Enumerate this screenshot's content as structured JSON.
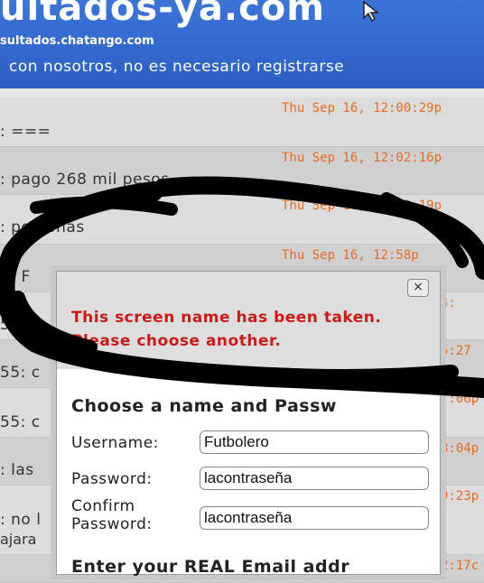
{
  "header": {
    "site_title": "ultados-ya.com",
    "site_url": "sultados.chatango.com",
    "tagline": "con nosotros, no es necesario registrarse"
  },
  "chat": {
    "rows": [
      {
        "message": ": ===",
        "timestamp": "Thu Sep 16, 12:00:29p"
      },
      {
        "message": ": pago 268 mil pesos",
        "timestamp": "Thu Sep 16, 12:02:16p"
      },
      {
        "message": ": personas",
        "timestamp": "Thu Sep 16, 12:02:19p"
      },
      {
        "message": "2: F",
        "timestamp": "Thu Sep 16, 12:58p"
      },
      {
        "message": "5: j",
        "timestamp": "4:"
      },
      {
        "message": "55: c",
        "timestamp": "5:27"
      },
      {
        "message": "55: c",
        "timestamp": "7:06p"
      },
      {
        "message": ": las",
        "timestamp": "8:04p"
      },
      {
        "message": ": no l",
        "message2": "ajara",
        "timestamp": "9:23p"
      },
      {
        "message": "",
        "timestamp": "2:17c"
      }
    ]
  },
  "dialog": {
    "close_label": "×",
    "error_message": "This screen name has been taken. Please choose another.",
    "form_heading": "Choose a name and Passw",
    "username_label": "Username:",
    "username_value": "Futbolero",
    "password_label": "Password:",
    "password_value": "lacontraseña",
    "confirm_label_line1": "Confirm",
    "confirm_label_line2": "Password:",
    "confirm_value": "lacontraseña",
    "email_heading": "Enter your REAL Email addr"
  },
  "colors": {
    "header_bg": "#2d5fc5",
    "timestamp": "#e86b20",
    "error": "#cc1a1a"
  }
}
